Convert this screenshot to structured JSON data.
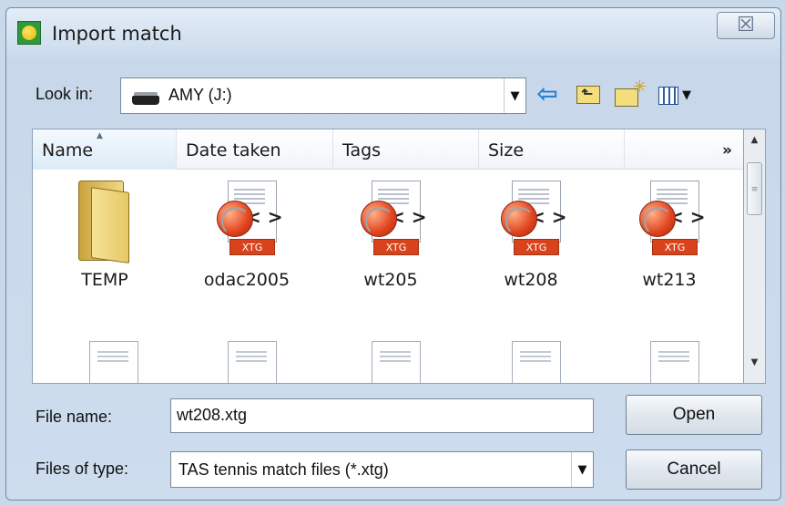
{
  "window": {
    "title": "Import match",
    "close_glyph": "☒"
  },
  "lookin": {
    "label": "Look in:",
    "value": "AMY (J:)"
  },
  "toolbar": {
    "back_icon": "back-arrow-icon",
    "up_icon": "up-folder-icon",
    "newfolder_icon": "new-folder-icon",
    "view_icon": "view-menu-icon"
  },
  "columns": {
    "name": "Name",
    "date": "Date taken",
    "tags": "Tags",
    "size": "Size",
    "more": "»"
  },
  "items": [
    {
      "label": "TEMP",
      "type": "folder"
    },
    {
      "label": "odac2005",
      "type": "xtg"
    },
    {
      "label": "wt205",
      "type": "xtg"
    },
    {
      "label": "wt208",
      "type": "xtg"
    },
    {
      "label": "wt213",
      "type": "xtg"
    }
  ],
  "xtg_badge": "XTG",
  "xtg_brackets": "< >",
  "filename": {
    "label": "File name:",
    "value": "wt208.xtg"
  },
  "filetype": {
    "label": "Files of type:",
    "value": "TAS tennis match files (*.xtg)"
  },
  "buttons": {
    "open": "Open",
    "cancel": "Cancel"
  },
  "colors": {
    "accent": "#1f7fd6",
    "xtg_badge": "#d9431c",
    "folder": "#f3dd7d"
  }
}
